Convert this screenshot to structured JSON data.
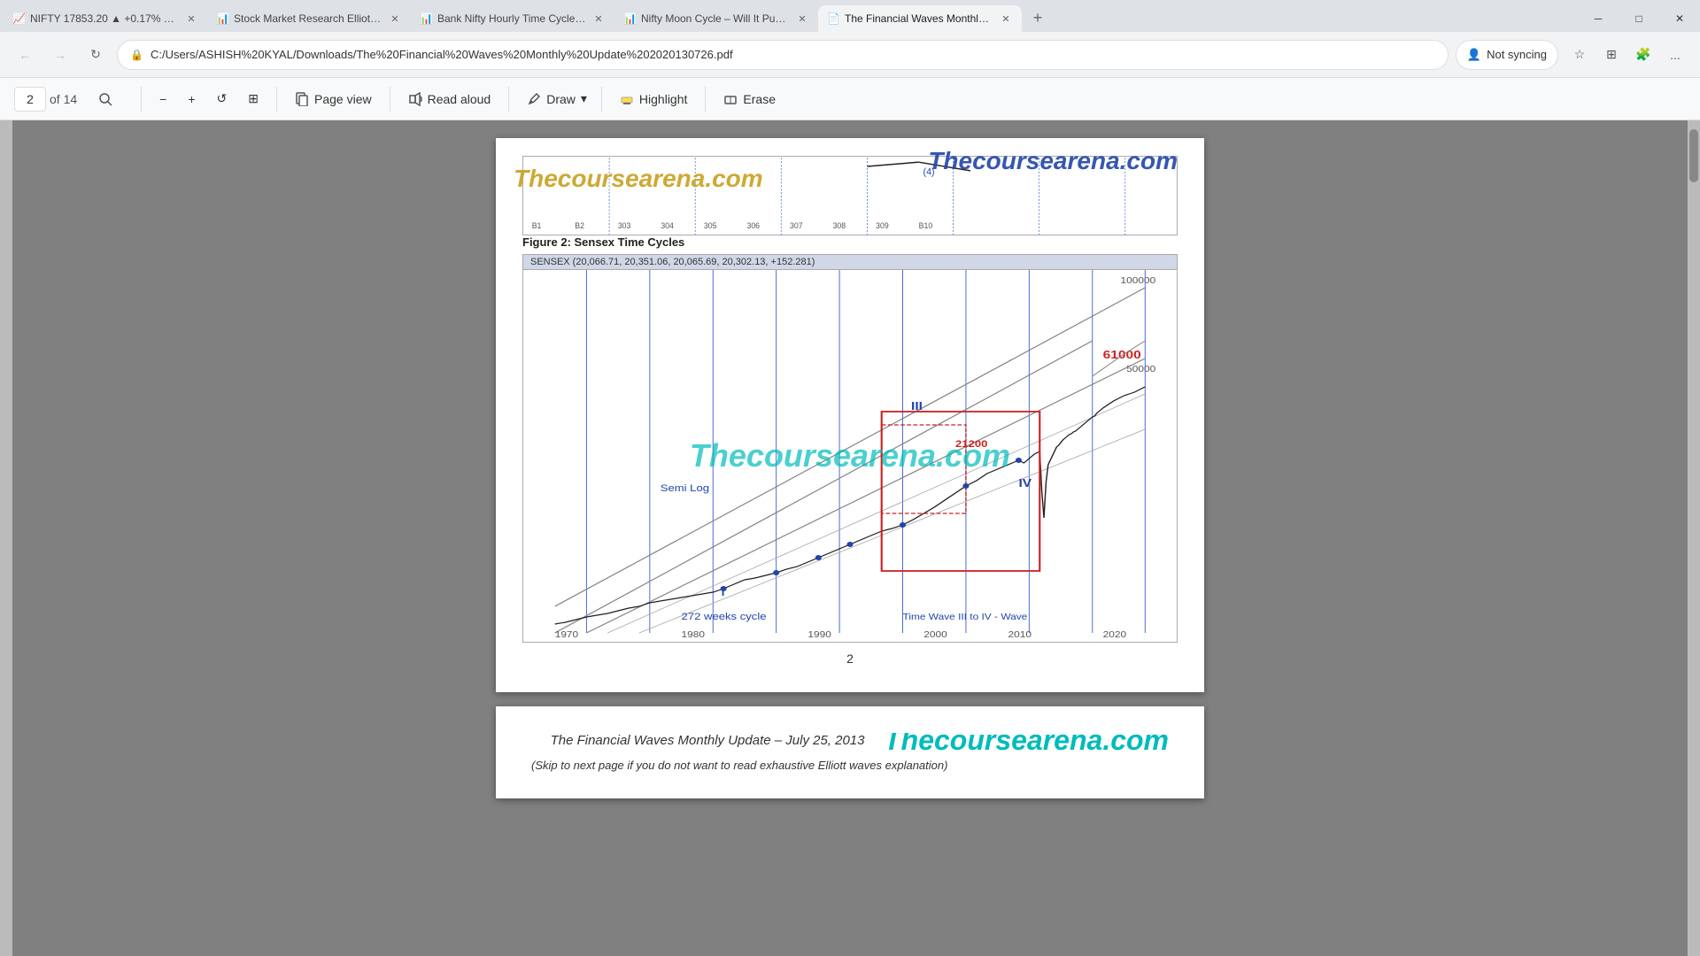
{
  "browser": {
    "tabs": [
      {
        "id": "tab1",
        "title": "NIFTY 17853.20 ▲ +0.17% Unn...",
        "active": false,
        "favicon": "📈"
      },
      {
        "id": "tab2",
        "title": "Stock Market Research Elliott W...",
        "active": false,
        "favicon": "📊"
      },
      {
        "id": "tab3",
        "title": "Bank Nifty Hourly Time Cycles...",
        "active": false,
        "favicon": "📊"
      },
      {
        "id": "tab4",
        "title": "Nifty Moon Cycle – Will It Push...",
        "active": false,
        "favicon": "📊"
      },
      {
        "id": "tab5",
        "title": "The Financial Waves Monthly U...",
        "active": true,
        "favicon": "📄"
      }
    ],
    "new_tab_label": "+",
    "window_controls": [
      "─",
      "□",
      "✕"
    ],
    "url": "C:/Users/ASHISH%20KYAL/Downloads/The%20Financial%20Waves%20Monthly%20Update%202020130726.pdf",
    "not_syncing_label": "Not syncing",
    "more_label": "..."
  },
  "pdf_toolbar": {
    "page_current": "2",
    "page_total": "14",
    "zoom_out": "−",
    "zoom_in": "+",
    "rotate": "↺",
    "fit_page": "⊞",
    "page_view_label": "Page view",
    "read_aloud_label": "Read aloud",
    "draw_label": "Draw",
    "highlight_label": "Highlight",
    "erase_label": "Erase"
  },
  "pdf_content": {
    "watermark_tl": "Thecoursearena.com",
    "watermark_tr": "Thecoursearena.com",
    "watermark_center": "Thecoursearena.com",
    "figure_label": "Figure 2: Sensex Time Cycles",
    "chart_header": "SENSEX (20,066.71, 20,351.06, 20,065.69, 20,302.13, +152.281)",
    "chart_right_scale": "100000",
    "chart_right_scale2": "50000",
    "label_semi_log": "Semi Log",
    "label_wave3": "III",
    "label_21200": "21200",
    "label_wave4": "IV",
    "label_61000": "61000",
    "label_272_cycle": "272 weeks cycle",
    "label_time_wave": "Time Wave III to IV - Wave",
    "x_labels": [
      "1970",
      "1980",
      "1990",
      "2000",
      "2010",
      "2020"
    ],
    "page_number": "2",
    "next_page_title": "The Financial Waves Monthly Update – July 25, 2013",
    "next_page_subtitle": "(Skip to next page  if you do not want to read exhaustive Elliott waves explanation)",
    "watermark_next": "Thecoursearena.com"
  }
}
